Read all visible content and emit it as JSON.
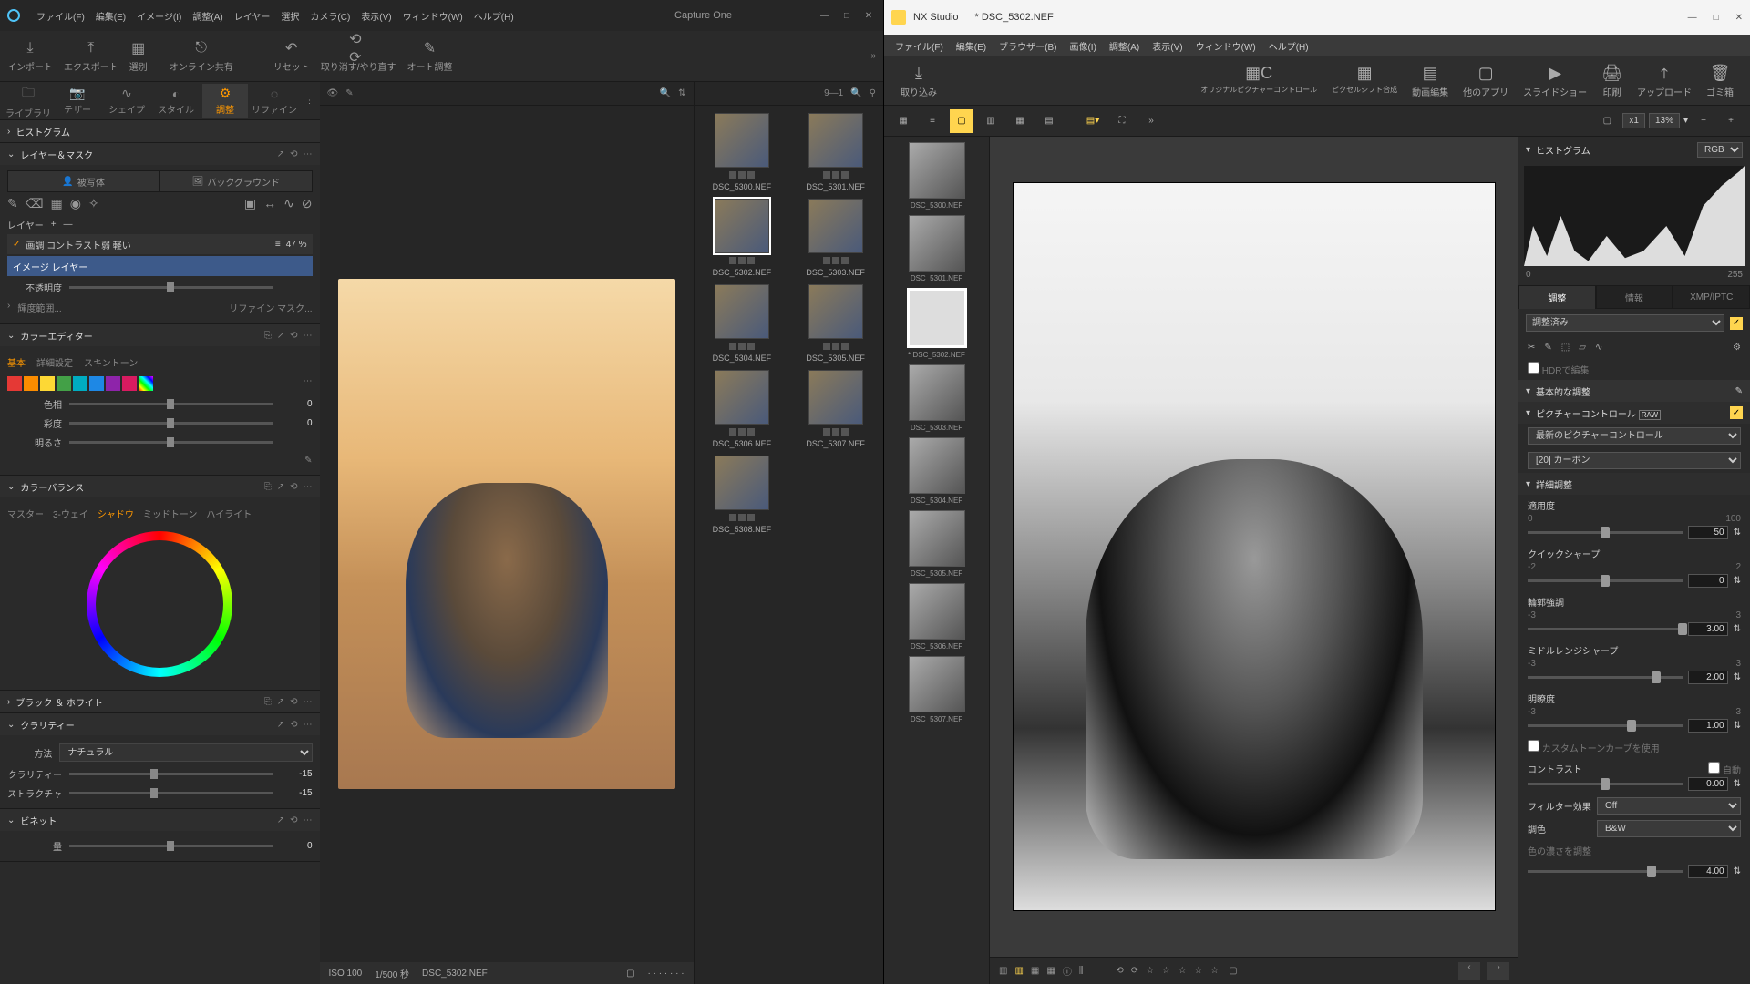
{
  "captureone": {
    "menu": [
      "ファイル(F)",
      "編集(E)",
      "イメージ(I)",
      "調整(A)",
      "レイヤー",
      "選択",
      "カメラ(C)",
      "表示(V)",
      "ウィンドウ(W)",
      "ヘルプ(H)"
    ],
    "title": "Capture One",
    "toolbar1": {
      "import": "インポート",
      "export": "エクスポート",
      "select": "選別",
      "share": "オンライン共有",
      "reset": "リセット",
      "undo": "取り消す/やり直す",
      "auto": "オート調整"
    },
    "tabs": {
      "library": "ライブラリ",
      "tether": "テザー",
      "shape": "シェイプ",
      "style": "スタイル",
      "adjust": "調整",
      "refine": "リファイン"
    },
    "panels": {
      "histogram": "ヒストグラム",
      "layers": {
        "title": "レイヤー＆マスク",
        "tab1": "被写体",
        "tab2": "バックグラウンド",
        "layerCtl": "レイヤー",
        "row1": "画調 コントラスト弱 軽い",
        "row1pct": "47 %",
        "row2": "イメージ レイヤー",
        "opacity": "不透明度",
        "lum": "輝度範囲...",
        "refine": "リファイン マスク..."
      },
      "colorEditor": {
        "title": "カラーエディター",
        "tabs": {
          "basic": "基本",
          "detail": "詳細設定",
          "skin": "スキントーン"
        },
        "hue": "色相",
        "sat": "彩度",
        "light": "明るさ",
        "val": "0"
      },
      "colorBalance": {
        "title": "カラーバランス",
        "tabs": {
          "master": "マスター",
          "three": "3-ウェイ",
          "shadow": "シャドウ",
          "mid": "ミッドトーン",
          "high": "ハイライト"
        }
      },
      "bw": "ブラック ＆ ホワイト",
      "clarity": {
        "title": "クラリティー",
        "method": "方法",
        "natural": "ナチュラル",
        "clarity": "クラリティー",
        "structure": "ストラクチャ",
        "v1": "-15",
        "v2": "-15"
      },
      "vignette": {
        "title": "ビネット",
        "amount": "量",
        "val": "0"
      }
    },
    "viewer": {
      "iso": "ISO 100",
      "shutter": "1/500 秒",
      "file": "DSC_5302.NEF",
      "browseLabel": "9—1"
    },
    "thumbs": [
      "DSC_5300.NEF",
      "DSC_5301.NEF",
      "DSC_5302.NEF",
      "DSC_5303.NEF",
      "DSC_5304.NEF",
      "DSC_5305.NEF",
      "DSC_5306.NEF",
      "DSC_5307.NEF",
      "DSC_5308.NEF"
    ]
  },
  "nxstudio": {
    "title": "NX Studio",
    "file": "* DSC_5302.NEF",
    "menu": [
      "ファイル(F)",
      "編集(E)",
      "ブラウザー(B)",
      "画像(I)",
      "調整(A)",
      "表示(V)",
      "ウィンドウ(W)",
      "ヘルプ(H)"
    ],
    "toolbar": {
      "import": "取り込み",
      "npc": "オリジナルピクチャーコントロール",
      "pixelshift": "ピクセルシフト合成",
      "movie": "動画編集",
      "other": "他のアプリ",
      "slideshow": "スライドショー",
      "print": "印刷",
      "upload": "アップロード",
      "trash": "ゴミ箱"
    },
    "zoom": {
      "x1": "x1",
      "pct": "13%"
    },
    "film": [
      "DSC_5300.NEF",
      "DSC_5301.NEF",
      "DSC_5302.NEF",
      "DSC_5303.NEF",
      "DSC_5304.NEF",
      "DSC_5305.NEF",
      "DSC_5306.NEF",
      "DSC_5307.NEF"
    ],
    "filmSelIdx": 2,
    "histogram": {
      "title": "ヒストグラム",
      "mode": "RGB",
      "min": "0",
      "max": "255"
    },
    "insp": {
      "tabs": {
        "adjust": "調整",
        "info": "情報",
        "xmp": "XMP/IPTC"
      },
      "preset": "調整済み",
      "hdr": "HDRで編集",
      "basic": {
        "title": "基本的な調整"
      },
      "picctrl": {
        "title": "ピクチャーコントロール",
        "badge": "RAW",
        "latest": "最新のピクチャーコントロール",
        "mode": "[20] カーボン"
      },
      "detail": {
        "title": "詳細調整",
        "apply": "適用度",
        "applyVal": "50",
        "applyMin": "0",
        "applyMax": "100",
        "qsharp": "クイックシャープ",
        "qsharpVal": "0",
        "qMin": "-2",
        "qMax": "2",
        "contour": "輪郭強調",
        "contourVal": "3.00",
        "cMin": "-3",
        "cMax": "3",
        "midsharp": "ミドルレンジシャープ",
        "midsharpVal": "2.00",
        "mMin": "-3",
        "mMax": "3",
        "clarity": "明瞭度",
        "clarityVal": "1.00",
        "clMin": "-3",
        "clMax": "3",
        "custom": "カスタムトーンカーブを使用",
        "contrast": "コントラスト",
        "auto": "自動",
        "contrastVal": "0.00",
        "filter": "フィルター効果",
        "filterVal": "Off",
        "tone": "調色",
        "toneVal": "B&W",
        "hueLock": "色の濃さを調整",
        "extraVal": "4.00"
      }
    }
  }
}
